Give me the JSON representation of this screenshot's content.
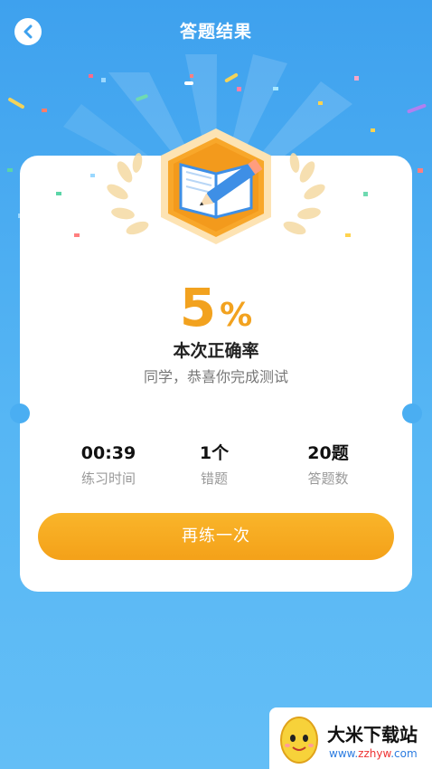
{
  "header": {
    "title": "答题结果",
    "back_icon": "chevron-left-icon"
  },
  "result": {
    "percent_value": "5",
    "percent_sign": "%",
    "label": "本次正确率",
    "congrats": "同学，恭喜你完成测试",
    "badge_icon": "book-pencil-badge-icon"
  },
  "stats": [
    {
      "value": "00:39",
      "label": "练习时间"
    },
    {
      "value": "1个",
      "label": "错题"
    },
    {
      "value": "20题",
      "label": "答题数"
    }
  ],
  "actions": {
    "retry_label": "再练一次"
  },
  "watermark": {
    "name": "大米下载站",
    "url_prefix": "www.",
    "url_accent": "zzhyw",
    "url_suffix": ".com"
  },
  "colors": {
    "background": "#4aaef2",
    "accent": "#f2a21f",
    "button": "#f6a81f"
  }
}
